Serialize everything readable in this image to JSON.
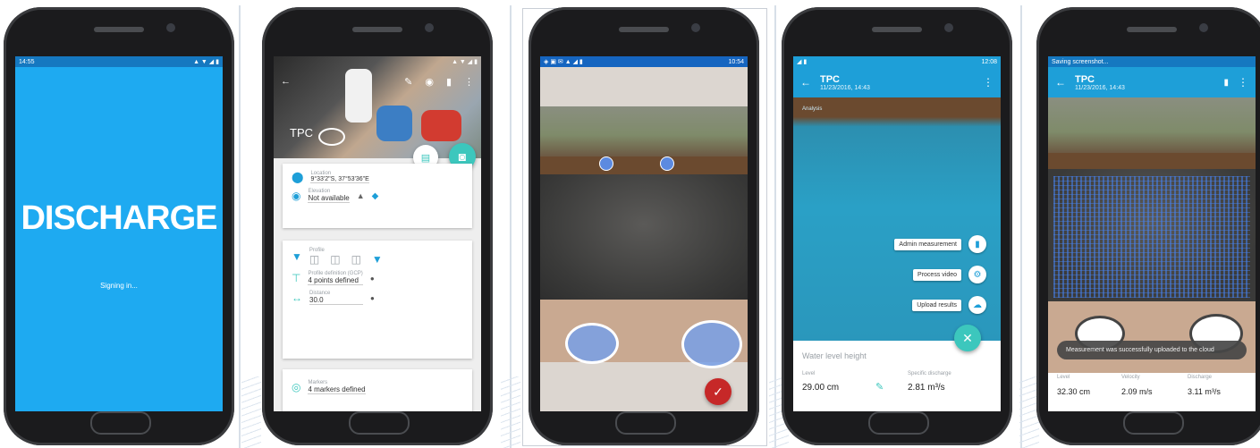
{
  "colors": {
    "accent": "#1eaaf1",
    "appbar": "#1e9fd8",
    "status_dark": "#1578c0",
    "fab_teal": "#3cc7bd",
    "fab_red": "#c62828"
  },
  "screen1": {
    "status_time": "14:55",
    "status_icons": "▲ ▼ ◢ ▮",
    "logo": "DISCHARGE",
    "status_text": "Signing in..."
  },
  "screen2": {
    "status_icons": "▲ ▼ ◢ ▮",
    "toolbar_icons": [
      "back-arrow-icon",
      "pencil-icon",
      "location-icon",
      "delete-icon",
      "more-vert-icon"
    ],
    "site_label": "TPC",
    "location": {
      "label": "Location",
      "value": "9°33'2\"S, 37°53'36\"E"
    },
    "elevation": {
      "label": "Elevation",
      "value": "Not available"
    },
    "profile": {
      "label": "Profile"
    },
    "control_points": {
      "label": "Profile definition (GCP)",
      "value": "4 points defined"
    },
    "distance": {
      "label": "Distance",
      "value": "30.0"
    },
    "markers": {
      "label": "Markers",
      "value": "4 markers defined"
    }
  },
  "screen3": {
    "status_time": "10:54",
    "status_icons": "◈ ▣ ✉ ▲ ◢ ▮"
  },
  "screen4": {
    "status_time": "12:08",
    "status_icons": "◢ ▮",
    "title": "TPC",
    "subtitle": "11/23/2016, 14:43",
    "preview_label": "Analysis",
    "actions": [
      "Admin measurement",
      "Process video",
      "Upload results"
    ],
    "water_level_label": "Water level height",
    "level": {
      "label": "Level",
      "value": "29.00 cm"
    },
    "discharge": {
      "label": "Specific discharge",
      "value": "2.81 m³/s"
    }
  },
  "screen5": {
    "status_text": "Saving screenshot...",
    "title": "TPC",
    "subtitle": "11/23/2016, 14:43",
    "toast": "Measurement was successfully uploaded to the cloud",
    "level": {
      "label": "Level",
      "value": "32.30 cm"
    },
    "velocity": {
      "label": "Velocity",
      "value": "2.09 m/s"
    },
    "discharge": {
      "label": "Discharge",
      "value": "3.11 m³/s"
    }
  }
}
